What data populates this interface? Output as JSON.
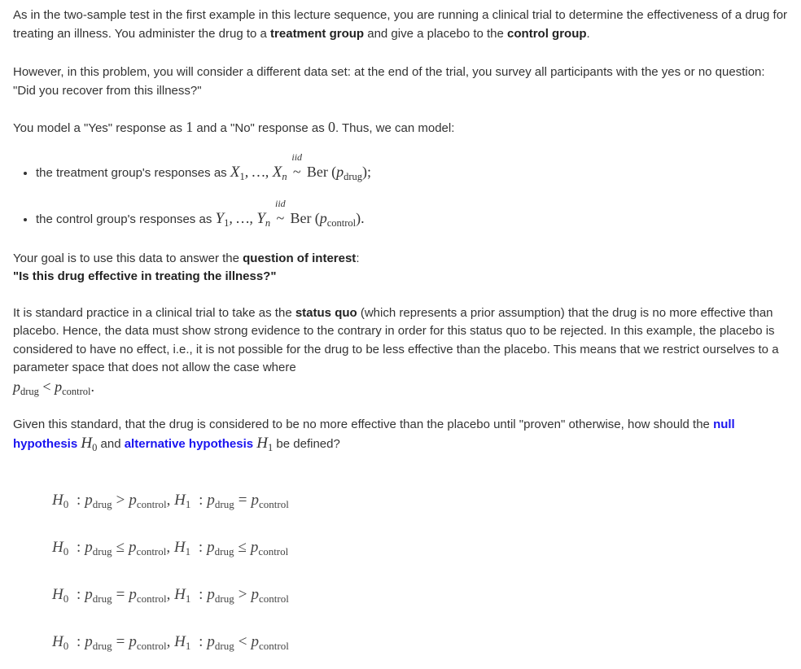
{
  "intro": {
    "p1_a": "As in the two-sample test in the first example in this lecture sequence, you are running a clinical trial to determine the effectiveness of a drug for treating an illness. You administer the drug to a ",
    "p1_b": "treatment group",
    "p1_c": " and give a placebo to the ",
    "p1_d": "control group",
    "p1_e": ".",
    "p2": "However, in this problem, you will consider a different data set: at the end of the trial, you survey all participants with the yes or no question: \"Did you recover from this illness?\"",
    "p3_a": "You model a \"Yes\" response as ",
    "p3_one": "1",
    "p3_b": " and a \"No\" response as ",
    "p3_zero": "0",
    "p3_c": ". Thus, we can model:"
  },
  "bullets": [
    {
      "text": "the treatment group's responses as ",
      "var": "X",
      "sub1": "1",
      "subn": "n",
      "iid": "iid",
      "ber": "Ber",
      "param": "drug",
      "end": ";"
    },
    {
      "text": "the control group's responses as ",
      "var": "Y",
      "sub1": "1",
      "subn": "n",
      "iid": "iid",
      "ber": "Ber",
      "param": "control",
      "end": "."
    }
  ],
  "goal": {
    "a": "Your goal is to use this data to answer the ",
    "b": "question of interest",
    "c": ":",
    "question": "\"Is this drug effective in treating the illness?\""
  },
  "status": {
    "a": "It is standard practice in a clinical trial to take as the ",
    "b": "status quo",
    "c": " (which represents a prior assumption) that the drug is no more effective than placebo. Hence, the data must show strong evidence to the contrary in order for this status quo to be rejected. In this example, the placebo is considered to have no effect, i.e., it is not possible for the drug to be less effective than the placebo. This means that we restrict ourselves to a parameter space that does not allow the case where ",
    "math": "p_drug < p_control",
    "end": "."
  },
  "question": {
    "a": "Given this standard, that the drug is considered to be no more effective than the placebo until \"proven\" otherwise, how should the ",
    "null": "null hypothesis",
    "b": " and ",
    "alt": "alternative hypothesis",
    "c": " be defined?",
    "h0": "H",
    "h0_sub": "0",
    "h1": "H",
    "h1_sub": "1"
  },
  "options": [
    {
      "h0_op": ">",
      "h1_op": "="
    },
    {
      "h0_op": "≤",
      "h1_op": "≤"
    },
    {
      "h0_op": "=",
      "h1_op": ">"
    },
    {
      "h0_op": "=",
      "h1_op": "<"
    }
  ],
  "symbols": {
    "H": "H",
    "zero": "0",
    "one": "1",
    "colon": ":",
    "p": "p",
    "drug": "drug",
    "control": "control",
    "lt": "<",
    "comma": ","
  },
  "colors": {
    "text": "#333333",
    "highlight": "#1a14f0"
  }
}
